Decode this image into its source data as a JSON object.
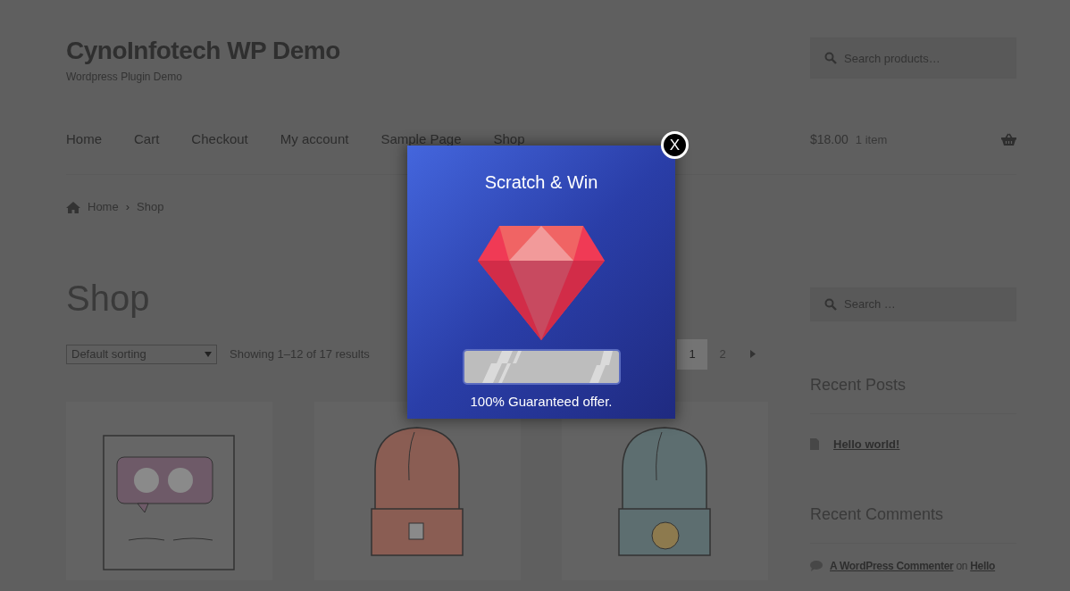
{
  "site": {
    "title": "CynoInfotech WP Demo",
    "tagline": "Wordpress Plugin Demo"
  },
  "header_search": {
    "placeholder": "Search products…"
  },
  "nav": [
    {
      "label": "Home"
    },
    {
      "label": "Cart"
    },
    {
      "label": "Checkout"
    },
    {
      "label": "My account"
    },
    {
      "label": "Sample Page"
    },
    {
      "label": "Shop"
    }
  ],
  "cart": {
    "total": "$18.00",
    "count": "1 item"
  },
  "breadcrumb": [
    {
      "label": "Home",
      "kind": "link"
    },
    {
      "label": "›",
      "kind": "separator"
    },
    {
      "label": "Shop",
      "kind": "current"
    }
  ],
  "heading": "Shop",
  "sorting": {
    "value": "Default sorting"
  },
  "result_count": "Showing 1–12 of 17 results",
  "pagination": [
    {
      "label": "1",
      "selected": true
    },
    {
      "label": "2",
      "selected": false
    }
  ],
  "sidebar": {
    "search": {
      "placeholder": "Search …"
    },
    "recent_posts": {
      "title": "Recent Posts",
      "items": [
        "Hello world!"
      ]
    },
    "recent_comments": {
      "title": "Recent Comments",
      "items": [
        {
          "author": "A WordPress Commenter",
          "joiner": "on",
          "post": "Hello"
        }
      ]
    }
  },
  "popup": {
    "title": "Scratch & Win",
    "offer": "100% Guaranteed offer.",
    "close": "X"
  }
}
